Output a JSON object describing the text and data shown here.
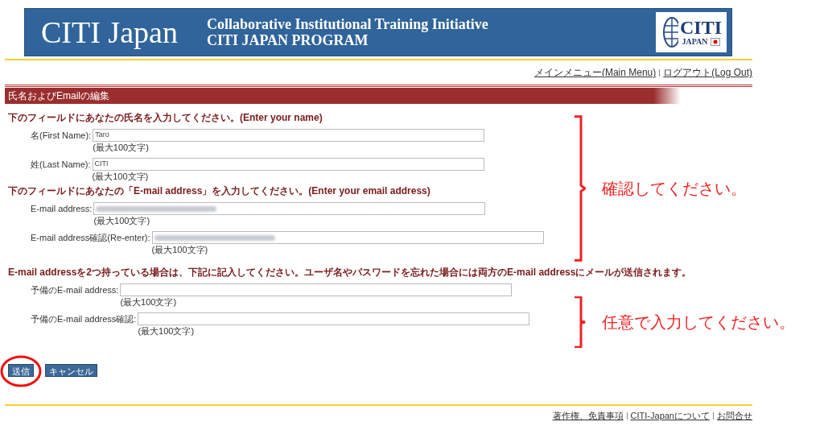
{
  "header": {
    "title": "CITI Japan",
    "subtitle_lines": [
      "Collaborative Institutional Training Initiative",
      "CITI JAPAN PROGRAM"
    ],
    "logo_text": "CITI",
    "logo_sub": "JAPAN"
  },
  "top_links": [
    "メインメニュー(Main Menu)",
    "ログアウト(Log Out)"
  ],
  "page_title": "氏名およびEmailの編集",
  "sections": [
    {
      "heading": "下のフィールドにあなたの氏名を入力してください。(Enter your name)",
      "fields": [
        {
          "label": "名(First Name):",
          "value": "Taro",
          "blurred": false,
          "hint": "(最大100文字)"
        },
        {
          "label": "姓(Last Name):",
          "value": "CITI",
          "blurred": false,
          "hint": "(最大100文字)"
        }
      ]
    },
    {
      "heading": "下のフィールドにあなたの「E-mail address」を入力してください。(Enter your email address)",
      "fields": [
        {
          "label": "E-mail address:",
          "blurred": true,
          "hint": "(最大100文字)"
        },
        {
          "label": "E-mail address確認(Re-enter):",
          "blurred": true,
          "hint": "(最大100文字)"
        }
      ]
    },
    {
      "heading": "E-mail addressを2つ持っている場合は、下記に記入してください。ユーザ名やパスワードを忘れた場合には両方のE-mail addressにメールが送信されます。",
      "fields": [
        {
          "label": "予備のE-mail address:",
          "blurred": false,
          "hint": "(最大100文字)"
        },
        {
          "label": "予備のE-mail address確認:",
          "blurred": false,
          "hint": "(最大100文字)"
        }
      ]
    }
  ],
  "buttons": [
    "送信",
    "キャンセル"
  ],
  "footer_links": [
    "著作権、免責事項",
    "CITI-Japanについて",
    "お問合せ"
  ],
  "annotations": [
    "確認してください。",
    "任意で入力してください。"
  ]
}
